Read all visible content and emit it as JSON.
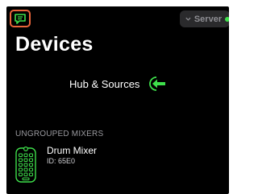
{
  "header": {
    "chat_icon": "chat-bubble-icon",
    "server_label": "Server",
    "server_status_color": "#3ee04b",
    "accent_color": "#e8643a"
  },
  "main": {
    "title": "Devices",
    "hub_label": "Hub & Sources",
    "hub_icon": "arrow-left-icon",
    "hub_icon_color": "#3ee04b"
  },
  "sections": [
    {
      "header": "UNGROUPED MIXERS",
      "items": [
        {
          "name": "Drum Mixer",
          "id_line": "ID: 65E0",
          "icon": "mixer-device-icon"
        }
      ]
    }
  ]
}
